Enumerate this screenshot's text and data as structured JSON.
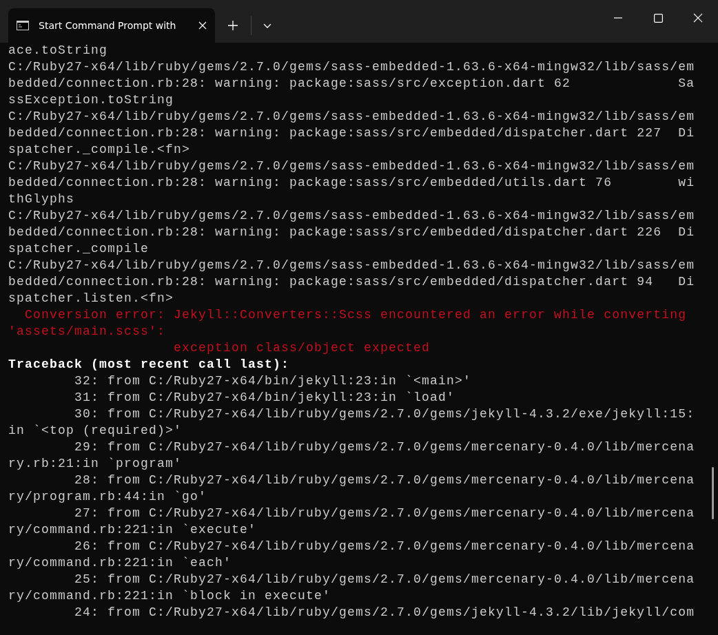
{
  "window": {
    "tab": {
      "title": "Start Command Prompt with",
      "selected": true
    }
  },
  "terminal": {
    "lines": [
      {
        "kind": "normal",
        "text": "ace.toString"
      },
      {
        "kind": "normal",
        "text": "C:/Ruby27-x64/lib/ruby/gems/2.7.0/gems/sass-embedded-1.63.6-x64-mingw32/lib/sass/em"
      },
      {
        "kind": "normal",
        "text": "bedded/connection.rb:28: warning: package:sass/src/exception.dart 62             Sa"
      },
      {
        "kind": "normal",
        "text": "ssException.toString"
      },
      {
        "kind": "normal",
        "text": "C:/Ruby27-x64/lib/ruby/gems/2.7.0/gems/sass-embedded-1.63.6-x64-mingw32/lib/sass/em"
      },
      {
        "kind": "normal",
        "text": "bedded/connection.rb:28: warning: package:sass/src/embedded/dispatcher.dart 227  Di"
      },
      {
        "kind": "normal",
        "text": "spatcher._compile.<fn>"
      },
      {
        "kind": "normal",
        "text": "C:/Ruby27-x64/lib/ruby/gems/2.7.0/gems/sass-embedded-1.63.6-x64-mingw32/lib/sass/em"
      },
      {
        "kind": "normal",
        "text": "bedded/connection.rb:28: warning: package:sass/src/embedded/utils.dart 76        wi"
      },
      {
        "kind": "normal",
        "text": "thGlyphs"
      },
      {
        "kind": "normal",
        "text": "C:/Ruby27-x64/lib/ruby/gems/2.7.0/gems/sass-embedded-1.63.6-x64-mingw32/lib/sass/em"
      },
      {
        "kind": "normal",
        "text": "bedded/connection.rb:28: warning: package:sass/src/embedded/dispatcher.dart 226  Di"
      },
      {
        "kind": "normal",
        "text": "spatcher._compile"
      },
      {
        "kind": "normal",
        "text": "C:/Ruby27-x64/lib/ruby/gems/2.7.0/gems/sass-embedded-1.63.6-x64-mingw32/lib/sass/em"
      },
      {
        "kind": "normal",
        "text": "bedded/connection.rb:28: warning: package:sass/src/embedded/dispatcher.dart 94   Di"
      },
      {
        "kind": "normal",
        "text": "spatcher.listen.<fn>"
      },
      {
        "kind": "error",
        "text": "  Conversion error: Jekyll::Converters::Scss encountered an error while converting"
      },
      {
        "kind": "error",
        "text": "'assets/main.scss':"
      },
      {
        "kind": "error",
        "text": "                    exception class/object expected"
      },
      {
        "kind": "bold",
        "text": "Traceback (most recent call last):"
      },
      {
        "kind": "normal",
        "text": "        32: from C:/Ruby27-x64/bin/jekyll:23:in `<main>'"
      },
      {
        "kind": "normal",
        "text": "        31: from C:/Ruby27-x64/bin/jekyll:23:in `load'"
      },
      {
        "kind": "normal",
        "text": "        30: from C:/Ruby27-x64/lib/ruby/gems/2.7.0/gems/jekyll-4.3.2/exe/jekyll:15:"
      },
      {
        "kind": "normal",
        "text": "in `<top (required)>'"
      },
      {
        "kind": "normal",
        "text": "        29: from C:/Ruby27-x64/lib/ruby/gems/2.7.0/gems/mercenary-0.4.0/lib/mercena"
      },
      {
        "kind": "normal",
        "text": "ry.rb:21:in `program'"
      },
      {
        "kind": "normal",
        "text": "        28: from C:/Ruby27-x64/lib/ruby/gems/2.7.0/gems/mercenary-0.4.0/lib/mercena"
      },
      {
        "kind": "normal",
        "text": "ry/program.rb:44:in `go'"
      },
      {
        "kind": "normal",
        "text": "        27: from C:/Ruby27-x64/lib/ruby/gems/2.7.0/gems/mercenary-0.4.0/lib/mercena"
      },
      {
        "kind": "normal",
        "text": "ry/command.rb:221:in `execute'"
      },
      {
        "kind": "normal",
        "text": "        26: from C:/Ruby27-x64/lib/ruby/gems/2.7.0/gems/mercenary-0.4.0/lib/mercena"
      },
      {
        "kind": "normal",
        "text": "ry/command.rb:221:in `each'"
      },
      {
        "kind": "normal",
        "text": "        25: from C:/Ruby27-x64/lib/ruby/gems/2.7.0/gems/mercenary-0.4.0/lib/mercena"
      },
      {
        "kind": "normal",
        "text": "ry/command.rb:221:in `block in execute'"
      },
      {
        "kind": "normal",
        "text": "        24: from C:/Ruby27-x64/lib/ruby/gems/2.7.0/gems/jekyll-4.3.2/lib/jekyll/com"
      }
    ]
  }
}
